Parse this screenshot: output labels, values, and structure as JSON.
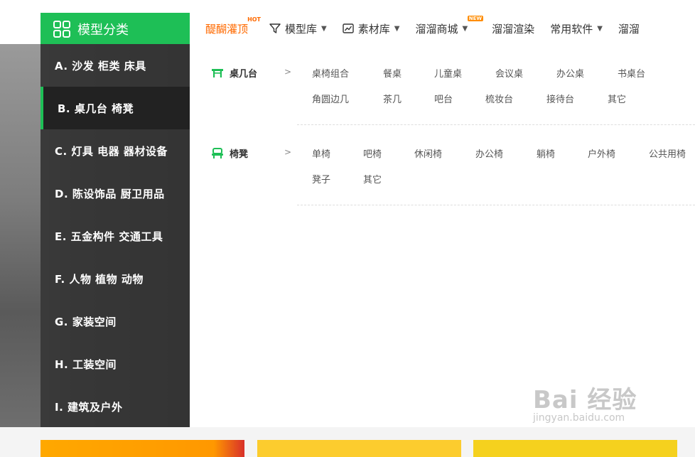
{
  "header": {
    "category_title": "模型分类",
    "nav": [
      {
        "label": "醍醐灌顶",
        "badge": "HOT",
        "icon": "",
        "dropdown": false
      },
      {
        "label": "模型库",
        "badge": "",
        "icon": "funnel-icon",
        "dropdown": true
      },
      {
        "label": "素材库",
        "badge": "",
        "icon": "chart-icon",
        "dropdown": true
      },
      {
        "label": "溜溜商城",
        "badge": "NEW",
        "icon": "",
        "dropdown": true
      },
      {
        "label": "溜溜渲染",
        "badge": "",
        "icon": "",
        "dropdown": false
      },
      {
        "label": "常用软件",
        "badge": "",
        "icon": "",
        "dropdown": true
      },
      {
        "label": "溜溜",
        "badge": "",
        "icon": "",
        "dropdown": false
      }
    ]
  },
  "sidebar": {
    "items": [
      {
        "label": "A.  沙发  柜类  床具"
      },
      {
        "label": "B.  桌几台  椅凳",
        "active": true
      },
      {
        "label": "C.  灯具  电器  器材设备"
      },
      {
        "label": "D.  陈设饰品  厨卫用品"
      },
      {
        "label": "E.  五金构件  交通工具"
      },
      {
        "label": "F.  人物  植物  动物"
      },
      {
        "label": "G.  家装空间"
      },
      {
        "label": "H.  工装空间"
      },
      {
        "label": "I.   建筑及户外"
      }
    ]
  },
  "panel": {
    "groups": [
      {
        "title": "桌几台",
        "arrow": ">",
        "icon": "table-icon",
        "items": [
          "桌椅组合",
          "餐桌",
          "儿童桌",
          "会议桌",
          "办公桌",
          "书桌台",
          "角圆边几",
          "茶几",
          "吧台",
          "梳妆台",
          "接待台",
          "其它"
        ]
      },
      {
        "title": "椅凳",
        "arrow": ">",
        "icon": "chair-icon",
        "items": [
          "单椅",
          "吧椅",
          "休闲椅",
          "办公椅",
          "躺椅",
          "户外椅",
          "公共用椅",
          "凳子",
          "其它"
        ]
      }
    ]
  },
  "watermark": {
    "main": "Bai  经验",
    "sub": "jingyan.baidu.com"
  },
  "colors": {
    "accent": "#1ebf56",
    "hot": "#ff6a00"
  }
}
